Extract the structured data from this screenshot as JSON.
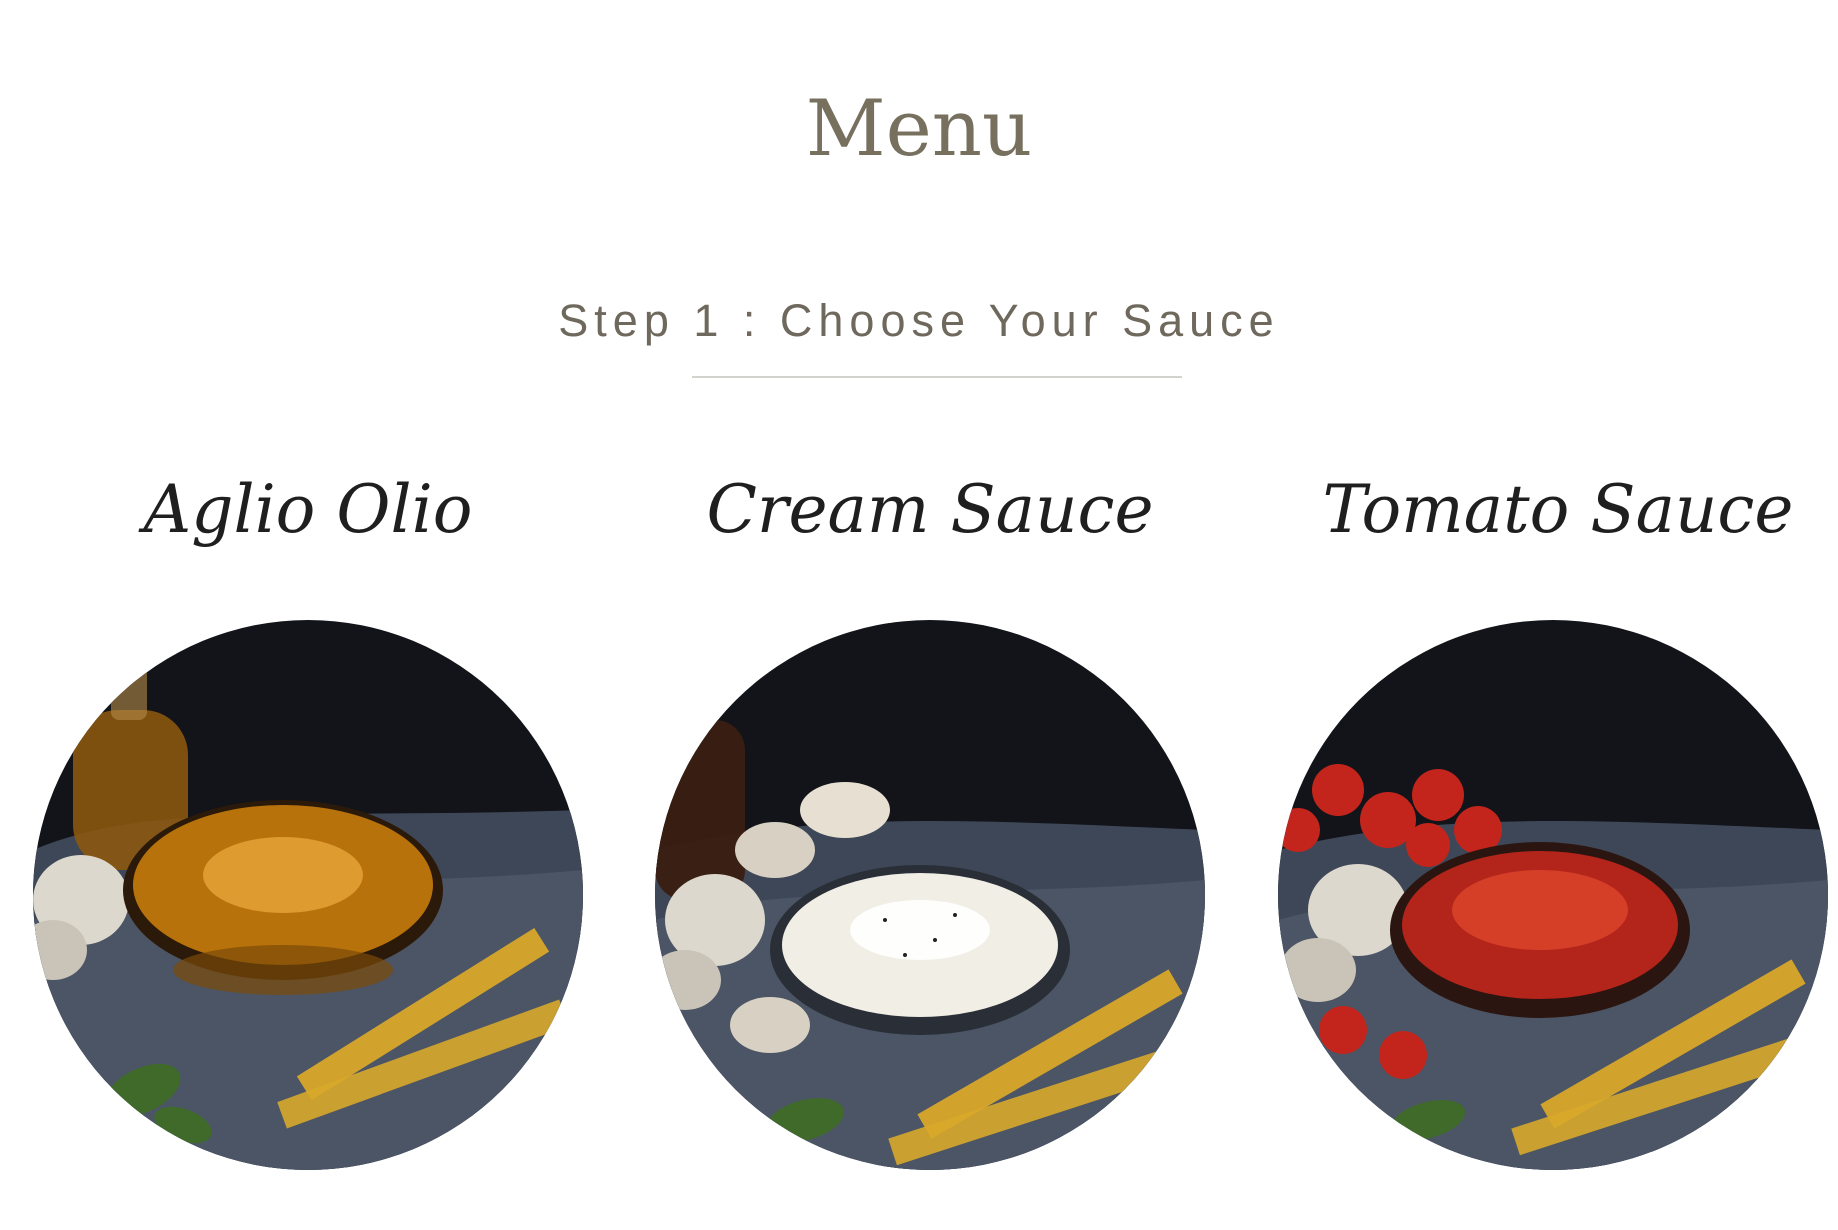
{
  "page": {
    "title": "Menu",
    "step_heading": "Step 1 : Choose Your Sauce"
  },
  "sauces": [
    {
      "name": "Aglio Olio",
      "bowl_color": "#b8720c",
      "bowl_highlight": "#e7a53a"
    },
    {
      "name": "Cream Sauce",
      "bowl_color": "#f1eee6",
      "bowl_highlight": "#ffffff"
    },
    {
      "name": "Tomato Sauce",
      "bowl_color": "#b3241a",
      "bowl_highlight": "#d8432a"
    }
  ],
  "colors": {
    "title": "#77705f",
    "subtitle": "#6f695d",
    "divider": "#d4d2ce",
    "sauce_name": "#1f1f1f",
    "photo_background": "#121419",
    "cloth": "#4c5667",
    "pasta": "#d8a82a"
  }
}
